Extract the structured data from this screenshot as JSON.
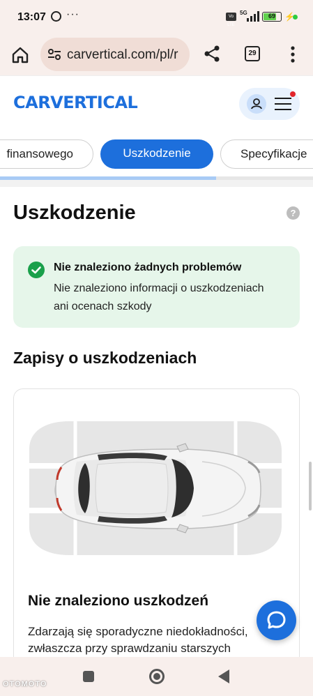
{
  "status_bar": {
    "time": "13:07",
    "more": "···",
    "network": "5G",
    "volte": "Vo LTE",
    "battery": "69"
  },
  "browser": {
    "url": "carvertical.com/pl/r",
    "tab_count": "29"
  },
  "site": {
    "logo_text": "CARVERTICAL",
    "brand_color": "#1d6fdc",
    "notification_color": "#e2262b"
  },
  "tabs": [
    {
      "label": "finansowego",
      "active": false
    },
    {
      "label": "Uszkodzenie",
      "active": true
    },
    {
      "label": "Specyfikacje",
      "active": false
    }
  ],
  "scroll_progress": 0.69,
  "section": {
    "title": "Uszkodzenie",
    "help": "?"
  },
  "status_box": {
    "title": "Nie znaleziono żadnych problemów",
    "description": "Nie znaleziono informacji o uszkodzeniach ani ocenach szkody"
  },
  "records": {
    "title": "Zapisy o uszkodzeniach",
    "card_title": "Nie znaleziono uszkodzeń",
    "card_text": "Zdarzają się sporadyczne niedokładności, zwłaszcza przy sprawdzaniu starszych"
  },
  "watermark": "OTOMOTO"
}
